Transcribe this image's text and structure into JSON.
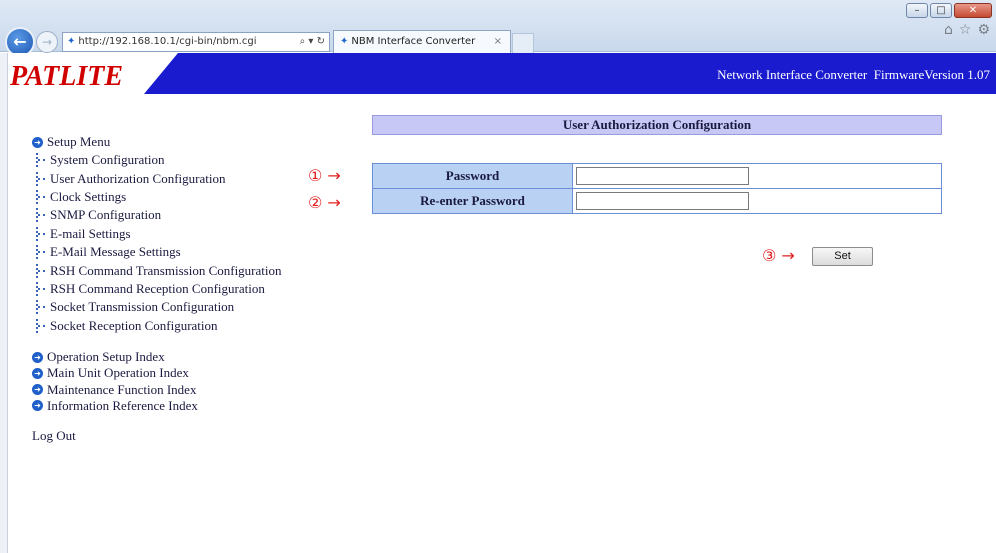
{
  "browser": {
    "address": "http://192.168.10.1/cgi-bin/nbm.cgi",
    "address_tools": "⌕ ▾ ↻",
    "tab_title": "NBM Interface Converter",
    "tab_close": "×",
    "back_glyph": "←",
    "forward_glyph": "→",
    "right_icons": [
      "home-icon",
      "star-icon",
      "gear-icon"
    ]
  },
  "header": {
    "logo": "PATLITE",
    "product": "Network Interface Converter",
    "firmware": "FirmwareVersion 1.07",
    "colors": {
      "band": "#1a1acf",
      "logo": "#d10000"
    }
  },
  "sidebar": {
    "setup_menu": "Setup Menu",
    "items": [
      "System Configuration",
      "User Authorization Configuration",
      "Clock Settings",
      "SNMP Configuration",
      "E-mail Settings",
      "E-Mail Message Settings",
      "RSH Command Transmission Configuration",
      "RSH Command Reception Configuration",
      "Socket Transmission Configuration",
      "Socket Reception Configuration"
    ],
    "indexes": [
      "Operation Setup Index",
      "Main Unit Operation Index",
      "Maintenance Function Index",
      "Information Reference Index"
    ],
    "logout": "Log Out"
  },
  "main": {
    "title": "User Authorization Configuration",
    "fields": {
      "password_label": "Password",
      "password_value": "",
      "reenter_label": "Re-enter Password",
      "reenter_value": ""
    },
    "set_button": "Set",
    "annotations": [
      "① →",
      "② →",
      "③ →"
    ]
  }
}
